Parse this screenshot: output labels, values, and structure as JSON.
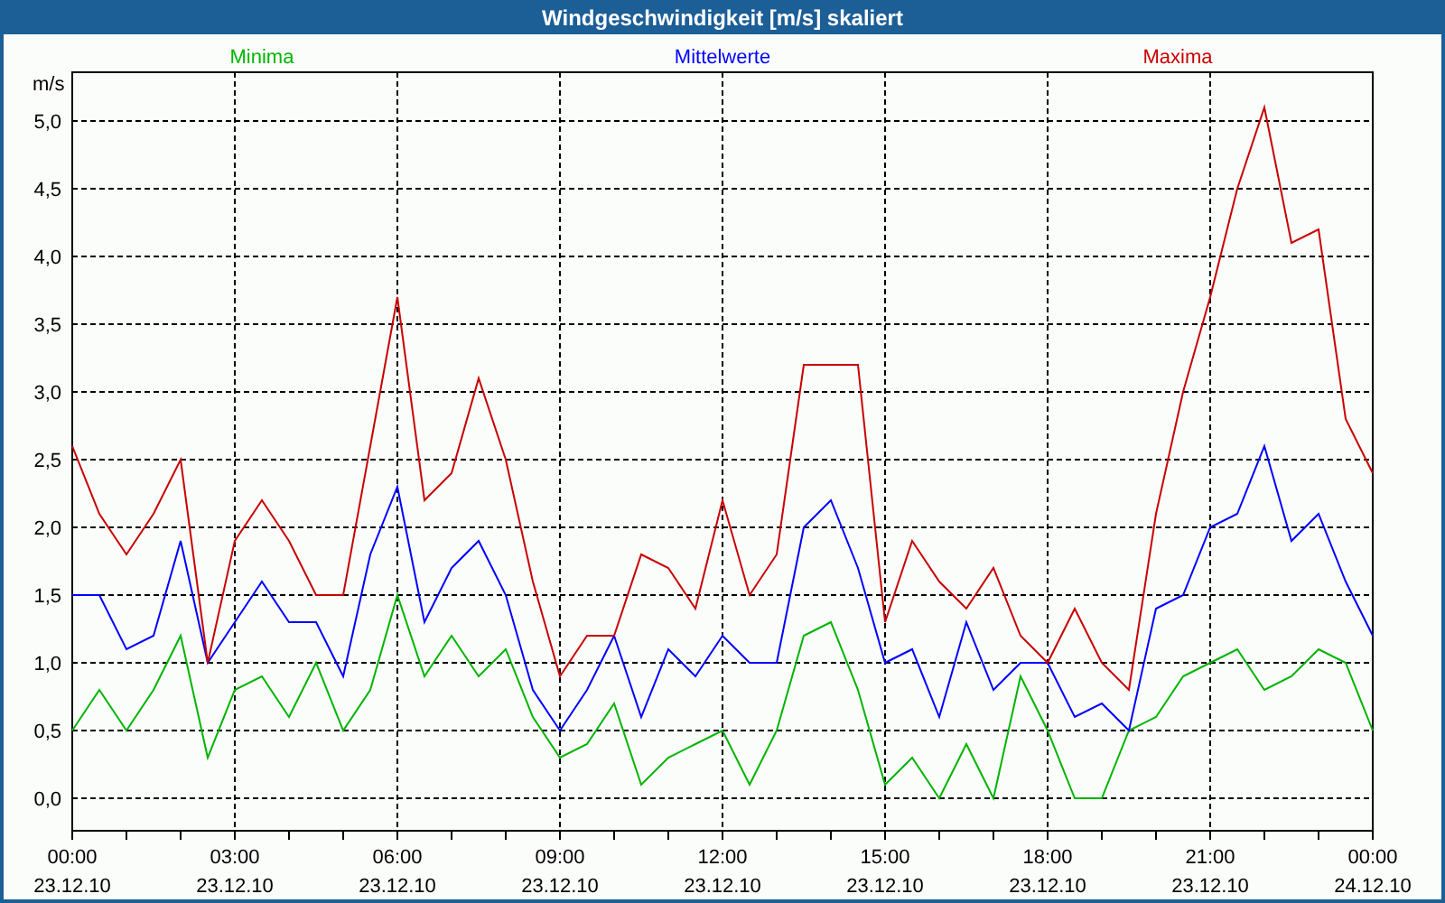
{
  "window": {
    "title": "Windgeschwindigkeit [m/s] skaliert"
  },
  "chart": {
    "chart_data": {
      "type": "line",
      "ylabel": "m/s",
      "categories": [
        "00:00\n23.12.10",
        null,
        null,
        null,
        null,
        null,
        "03:00\n23.12.10",
        null,
        null,
        null,
        null,
        null,
        "06:00\n23.12.10",
        null,
        null,
        null,
        null,
        null,
        "09:00\n23.12.10",
        null,
        null,
        null,
        null,
        null,
        "12:00\n23.12.10",
        null,
        null,
        null,
        null,
        null,
        "15:00\n23.12.10",
        null,
        null,
        null,
        null,
        null,
        "18:00\n23.12.10",
        null,
        null,
        null,
        null,
        null,
        "21:00\n23.12.10",
        null,
        null,
        null,
        null,
        null,
        "00:00\n24.12.10"
      ],
      "ylim": [
        -0.24,
        5.36
      ],
      "grid": true,
      "yticks": [
        {
          "value": 0,
          "label": "0,0"
        },
        {
          "value": 0.5,
          "label": "0,5"
        },
        {
          "value": 1,
          "label": "1,0"
        },
        {
          "value": 1.5,
          "label": "1,5"
        },
        {
          "value": 2,
          "label": "2,0"
        },
        {
          "value": 2.5,
          "label": "2,5"
        },
        {
          "value": 3,
          "label": "3,0"
        },
        {
          "value": 3.5,
          "label": "3,5"
        },
        {
          "value": 4,
          "label": "4,0"
        },
        {
          "value": 4.5,
          "label": "4,5"
        },
        {
          "value": 5,
          "label": "5,0"
        }
      ],
      "series": [
        {
          "name": "Minima",
          "color": "#00b400",
          "values": [
            0.5,
            0.8,
            0.5,
            0.8,
            1.2,
            0.3,
            0.8,
            0.9,
            0.6,
            1.0,
            0.5,
            0.8,
            1.5,
            0.9,
            1.2,
            0.9,
            1.1,
            0.6,
            0.3,
            0.4,
            0.7,
            0.1,
            0.3,
            0.4,
            0.5,
            0.1,
            0.5,
            1.2,
            1.3,
            0.8,
            0.1,
            0.3,
            0.0,
            0.4,
            0.0,
            0.9,
            0.5,
            0.0,
            0.0,
            0.5,
            0.6,
            0.9,
            1.0,
            1.1,
            0.8,
            0.9,
            1.1,
            1.0,
            0.5
          ]
        },
        {
          "name": "Mittelwerte",
          "color": "#0000ff",
          "values": [
            1.5,
            1.5,
            1.1,
            1.2,
            1.9,
            1.0,
            1.3,
            1.6,
            1.3,
            1.3,
            0.9,
            1.8,
            2.3,
            1.3,
            1.7,
            1.9,
            1.5,
            0.8,
            0.5,
            0.8,
            1.2,
            0.6,
            1.1,
            0.9,
            1.2,
            1.0,
            1.0,
            2.0,
            2.2,
            1.7,
            1.0,
            1.1,
            0.6,
            1.3,
            0.8,
            1.0,
            1.0,
            0.6,
            0.7,
            0.5,
            1.4,
            1.5,
            2.0,
            2.1,
            2.6,
            1.9,
            2.1,
            1.6,
            1.2
          ]
        },
        {
          "name": "Maxima",
          "color": "#c80000",
          "values": [
            2.6,
            2.1,
            1.8,
            2.1,
            2.5,
            1.0,
            1.9,
            2.2,
            1.9,
            1.5,
            1.5,
            2.6,
            3.7,
            2.2,
            2.4,
            3.1,
            2.5,
            1.6,
            0.9,
            1.2,
            1.2,
            1.8,
            1.7,
            1.4,
            2.2,
            1.5,
            1.8,
            3.2,
            3.2,
            3.2,
            1.3,
            1.9,
            1.6,
            1.4,
            1.7,
            1.2,
            1.0,
            1.4,
            1.0,
            0.8,
            2.1,
            3.0,
            3.7,
            4.5,
            5.1,
            4.1,
            4.2,
            2.8,
            2.4
          ]
        }
      ]
    }
  }
}
